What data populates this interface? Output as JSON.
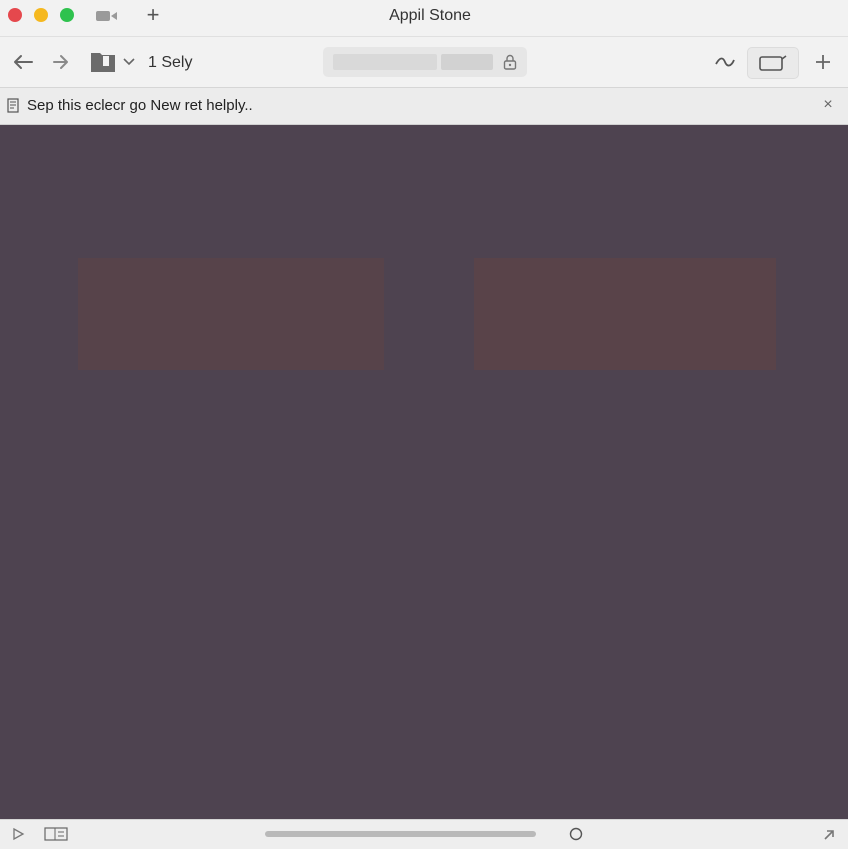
{
  "window": {
    "title": "Appil Stone",
    "controls": [
      "close",
      "minimize",
      "maximize"
    ]
  },
  "titlebar": {
    "new_tab_icon": "plus-icon",
    "camera_icon": "camera-icon"
  },
  "toolbar": {
    "back_icon": "arrow-left-icon",
    "forward_icon": "arrow-right-icon",
    "folder_icon": "folder-icon",
    "chevron": "chevron-down-icon",
    "breadcrumb": "1 Sely",
    "address_lock_icon": "lock-icon",
    "wave_icon": "wave-icon",
    "tabs_icon": "tabs-icon",
    "add_icon": "plus-icon"
  },
  "infobar": {
    "text": "Sep this eclecr go New ret helply..",
    "close": "×"
  },
  "bottombar": {
    "play_icon": "play-icon",
    "sidebar_icon": "sidebar-icon",
    "circle_icon": "circle-icon",
    "expand_icon": "arrow-up-right-icon"
  },
  "colors": {
    "content_bg": "#4e4350",
    "panel_left": "#57434a",
    "panel_right": "#594349",
    "close": "#e5484d",
    "minimize": "#f5b81f",
    "maximize": "#2fc24e"
  }
}
